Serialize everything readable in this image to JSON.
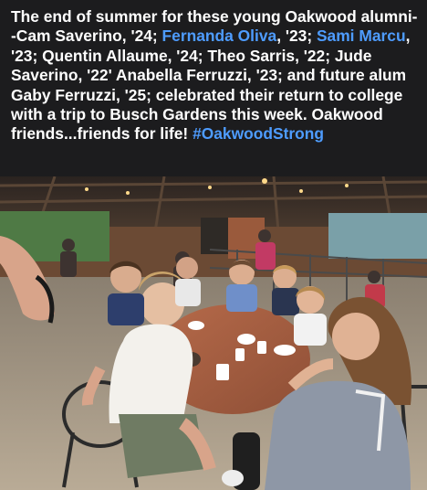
{
  "post": {
    "caption_parts": [
      {
        "text": "The end of summer for these young Oakwood alumni--Cam Saverino, '24; ",
        "kind": "plain"
      },
      {
        "text": "Fernanda Oliva",
        "kind": "tag"
      },
      {
        "text": ", '23; ",
        "kind": "plain"
      },
      {
        "text": "Sami Marcu",
        "kind": "tag"
      },
      {
        "text": ", '23; Quentin Allaume, '24; Theo Sarris, '22; Jude Saverino, '22' Anabella Ferruzzi, '23; and future alum Gaby Ferruzzi, '25; celebrated their return to college with a trip to Busch Gardens this week.  Oakwood friends...friends for life!  ",
        "kind": "plain"
      },
      {
        "text": "#OakwoodStrong",
        "kind": "tag"
      }
    ],
    "colors": {
      "background": "#1c1c1e",
      "text": "#ffffff",
      "tag": "#4e9cff"
    }
  }
}
